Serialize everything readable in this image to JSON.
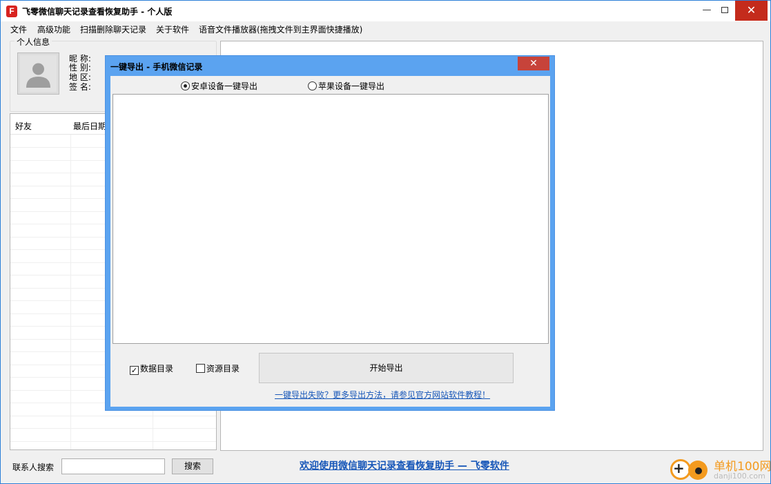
{
  "window": {
    "app_icon_letter": "F",
    "title": "飞零微信聊天记录查看恢复助手 - 个人版",
    "min_glyph": "—",
    "close_glyph": "✕"
  },
  "menu": [
    "文件",
    "高级功能",
    "扫描删除聊天记录",
    "关于软件",
    "语音文件播放器(拖拽文件到主界面快捷播放)"
  ],
  "profile": {
    "group_title": "个人信息",
    "labels": [
      "昵 称:",
      "性 别:",
      "地 区:",
      "签 名:"
    ]
  },
  "friends_list": {
    "columns": [
      "好友",
      "最后日期"
    ]
  },
  "search": {
    "label": "联系人搜索",
    "value": "",
    "button": "搜索"
  },
  "welcome_link": "欢迎使用微信聊天记录查看恢复助手 — 飞零软件",
  "watermark": {
    "text": "单机100网",
    "url": "danji100.com"
  },
  "dialog": {
    "title": "一键导出 - 手机微信记录",
    "close_glyph": "✕",
    "radio_android": "安卓设备一键导出",
    "radio_apple": "苹果设备一键导出",
    "selected": "android",
    "check_data": "数据目录",
    "check_data_checked": true,
    "check_resource": "资源目录",
    "check_resource_checked": false,
    "start_button": "开始导出",
    "help_link": "一键导出失败？更多导出方法，请参见官方网站软件教程！"
  }
}
